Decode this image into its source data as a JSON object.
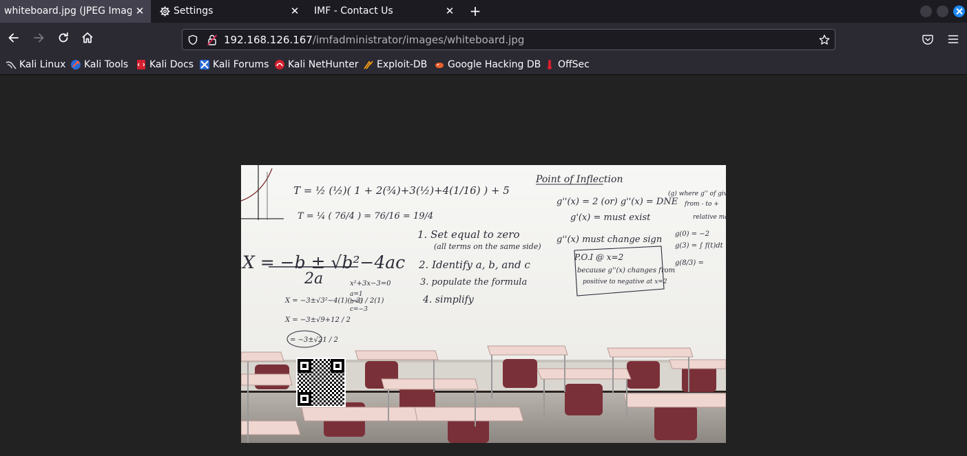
{
  "tabs": [
    {
      "label": "whiteboard.jpg (JPEG Image,",
      "active": true
    },
    {
      "label": "Settings",
      "active": false
    },
    {
      "label": "IMF - Contact Us",
      "active": false
    }
  ],
  "new_tab_symbol": "+",
  "close_symbol": "✕",
  "address": {
    "host": "192.168.126.167",
    "path": "/imfadministrator/images/whiteboard.jpg"
  },
  "bookmarks": [
    {
      "label": "Kali Linux",
      "icon": "kali-dragon-icon"
    },
    {
      "label": "Kali Tools",
      "icon": "kali-tools-icon"
    },
    {
      "label": "Kali Docs",
      "icon": "kali-docs-icon"
    },
    {
      "label": "Kali Forums",
      "icon": "kali-forums-icon"
    },
    {
      "label": "Kali NetHunter",
      "icon": "nethunter-icon"
    },
    {
      "label": "Exploit-DB",
      "icon": "exploit-db-icon"
    },
    {
      "label": "Google Hacking DB",
      "icon": "ghdb-icon"
    },
    {
      "label": "OffSec",
      "icon": "offsec-icon"
    }
  ],
  "whiteboard": {
    "formula_t1": "T = ½ (½)( 1 + 2(¾)+3(½)+4(1/16) ) + 5",
    "formula_t2": "T = ¼ ( 76/4 ) = 76/16 = 19/4",
    "quadratic": "X = −b ± √b²−4ac",
    "quadratic_den": "2a",
    "steps": [
      "1. Set equal to zero",
      "(all terms on the same side)",
      "2. Identify a, b, and c",
      "3. populate the formula",
      "4. simplify"
    ],
    "example_eq": "x²+3x−3=0",
    "coeffs": [
      "a=1",
      "b=3",
      "c=−3"
    ],
    "solve1": "X = −3±√3²−4(1)(−3) / 2(1)",
    "solve2": "X = −3±√9+12 / 2",
    "solve3": "= −3±√21 / 2",
    "poi_title": "Point of Inflection",
    "poi_lines": [
      "g''(x) = 2   (or)   g''(x) = DNE",
      "g'(x) = must exist",
      "g''(x) must change sign"
    ],
    "poi_box": [
      "P.O.I @ x=2",
      "because g''(x) changes from",
      "positive to negative at x=2"
    ],
    "right_notes": [
      "(g) where g'' of gives",
      "from - to +",
      "relative max",
      "g(0) = −2",
      "g(3) = ∫ f(t)dt",
      "g(8/3) ="
    ]
  }
}
